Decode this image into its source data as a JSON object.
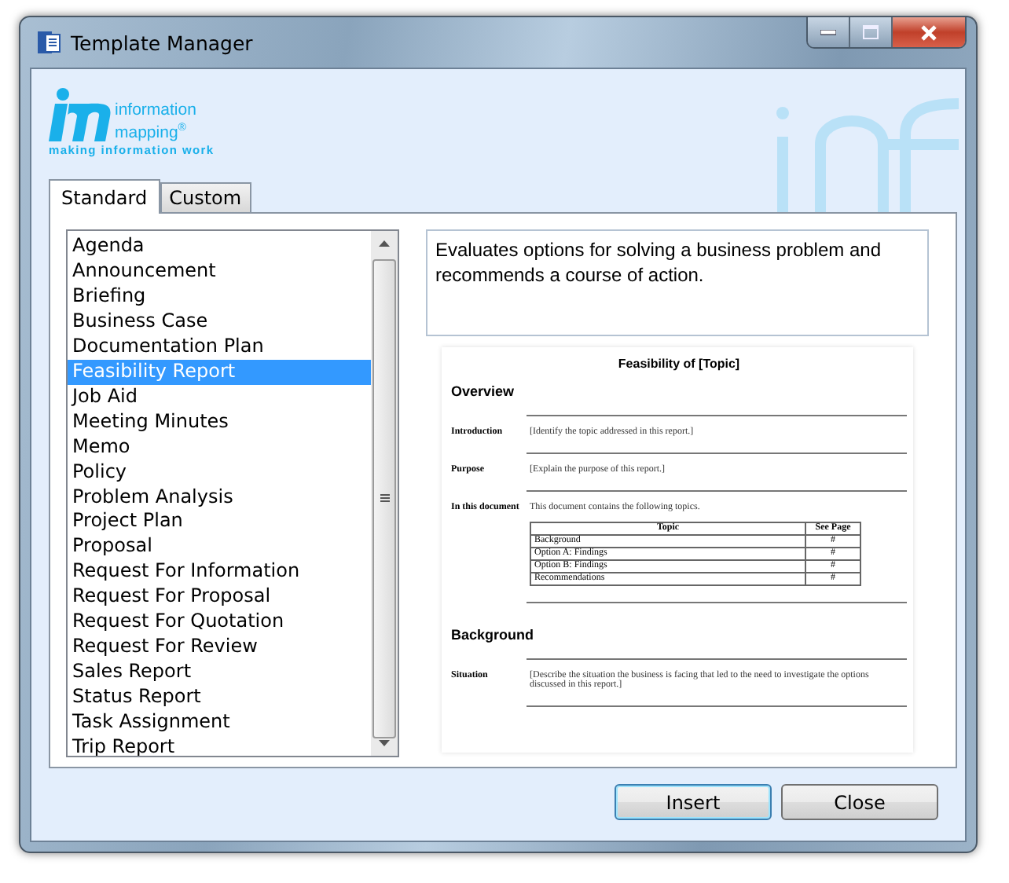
{
  "window": {
    "title": "Template Manager"
  },
  "logo": {
    "line_1": "information",
    "line_2": "mapping",
    "mark": "®",
    "tagline": "making information work"
  },
  "tabs": [
    {
      "label": "Standard",
      "selected": true
    },
    {
      "label": "Custom",
      "selected": false
    }
  ],
  "templates": [
    {
      "label": "Agenda",
      "selected": false
    },
    {
      "label": "Announcement",
      "selected": false
    },
    {
      "label": "Briefing",
      "selected": false
    },
    {
      "label": "Business Case",
      "selected": false
    },
    {
      "label": "Documentation Plan",
      "selected": false
    },
    {
      "label": "Feasibility Report",
      "selected": true
    },
    {
      "label": "Job Aid",
      "selected": false
    },
    {
      "label": "Meeting Minutes",
      "selected": false
    },
    {
      "label": "Memo",
      "selected": false
    },
    {
      "label": "Policy",
      "selected": false
    },
    {
      "label": "Problem Analysis",
      "selected": false
    },
    {
      "label": "Project Plan",
      "selected": false
    },
    {
      "label": "Proposal",
      "selected": false
    },
    {
      "label": "Request For Information",
      "selected": false
    },
    {
      "label": "Request For Proposal",
      "selected": false
    },
    {
      "label": "Request For Quotation",
      "selected": false
    },
    {
      "label": "Request For Review",
      "selected": false
    },
    {
      "label": "Sales Report",
      "selected": false
    },
    {
      "label": "Status Report",
      "selected": false
    },
    {
      "label": "Task Assignment",
      "selected": false
    },
    {
      "label": "Trip Report",
      "selected": false
    }
  ],
  "description": "Evaluates options for solving a business problem and recommends a course of action.",
  "preview": {
    "title": "Feasibility of [Topic]",
    "sections": [
      {
        "heading": "Overview",
        "rows": [
          {
            "label": "Introduction",
            "text": "[Identify the topic addressed in this report.]"
          },
          {
            "label": "Purpose",
            "text": "[Explain the purpose of this report.]"
          },
          {
            "label": "In this document",
            "text": "This document contains the following topics.",
            "table": {
              "columns": [
                "Topic",
                "See Page"
              ],
              "rows": [
                [
                  "Background",
                  "#"
                ],
                [
                  "Option A:  Findings",
                  "#"
                ],
                [
                  "Option B:  Findings",
                  "#"
                ],
                [
                  "Recommendations",
                  "#"
                ]
              ]
            }
          }
        ]
      },
      {
        "heading": "Background",
        "rows": [
          {
            "label": "Situation",
            "text": "[Describe the situation the business is facing that led to the need to investigate the options discussed in this report.]"
          }
        ]
      }
    ]
  },
  "buttons": [
    {
      "label": "Insert",
      "default": true
    },
    {
      "label": "Close",
      "default": false
    }
  ]
}
